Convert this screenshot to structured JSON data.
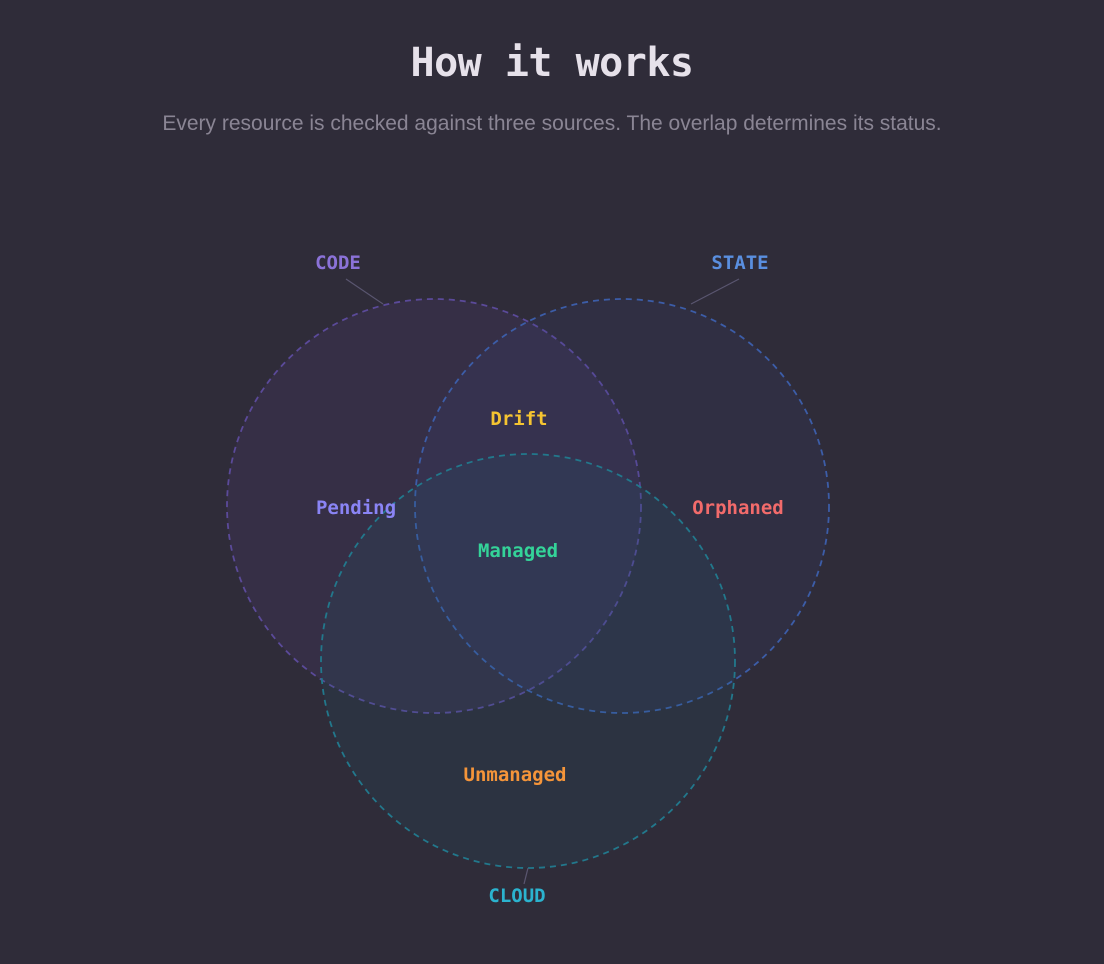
{
  "header": {
    "title": "How it works",
    "subtitle": "Every resource is checked against three sources. The overlap determines its status."
  },
  "diagram": {
    "sets": [
      {
        "key": "code",
        "label": "CODE",
        "color": "#8b72d8"
      },
      {
        "key": "state",
        "label": "STATE",
        "color": "#5a8fe0"
      },
      {
        "key": "cloud",
        "label": "CLOUD",
        "color": "#2bb3cf"
      }
    ],
    "regions": {
      "pending": {
        "label": "Pending",
        "color": "#8a84f5"
      },
      "drift": {
        "label": "Drift",
        "color": "#f5c431"
      },
      "orphaned": {
        "label": "Orphaned",
        "color": "#f26b6b"
      },
      "managed": {
        "label": "Managed",
        "color": "#34d399"
      },
      "unmanaged": {
        "label": "Unmanaged",
        "color": "#f5953a"
      }
    }
  }
}
